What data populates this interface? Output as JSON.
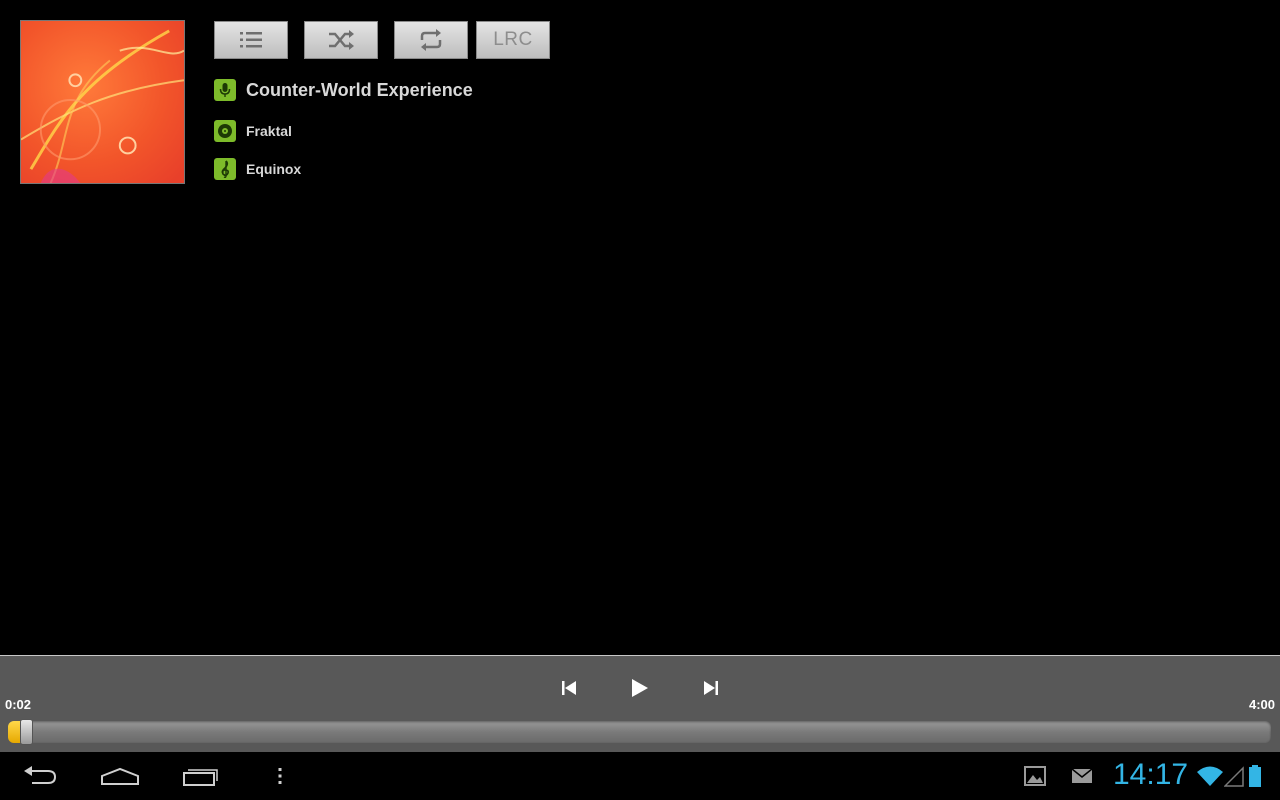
{
  "album": {
    "art_icon": "album-cover-orange-fractal"
  },
  "toolbar": {
    "playlist_icon": "list-icon",
    "shuffle_icon": "shuffle-icon",
    "repeat_icon": "repeat-icon",
    "lrc_label": "LRC"
  },
  "track": {
    "title": "Counter-World Experience",
    "album": "Fraktal",
    "artist": "Equinox"
  },
  "player": {
    "elapsed": "0:02",
    "duration": "4:00",
    "progress_fraction": 0.008
  },
  "status_bar": {
    "time": "14:17"
  },
  "colors": {
    "accent_green": "#7dbb2a",
    "clock_blue": "#33b5e5",
    "progress_yellow": "#f5c518"
  }
}
